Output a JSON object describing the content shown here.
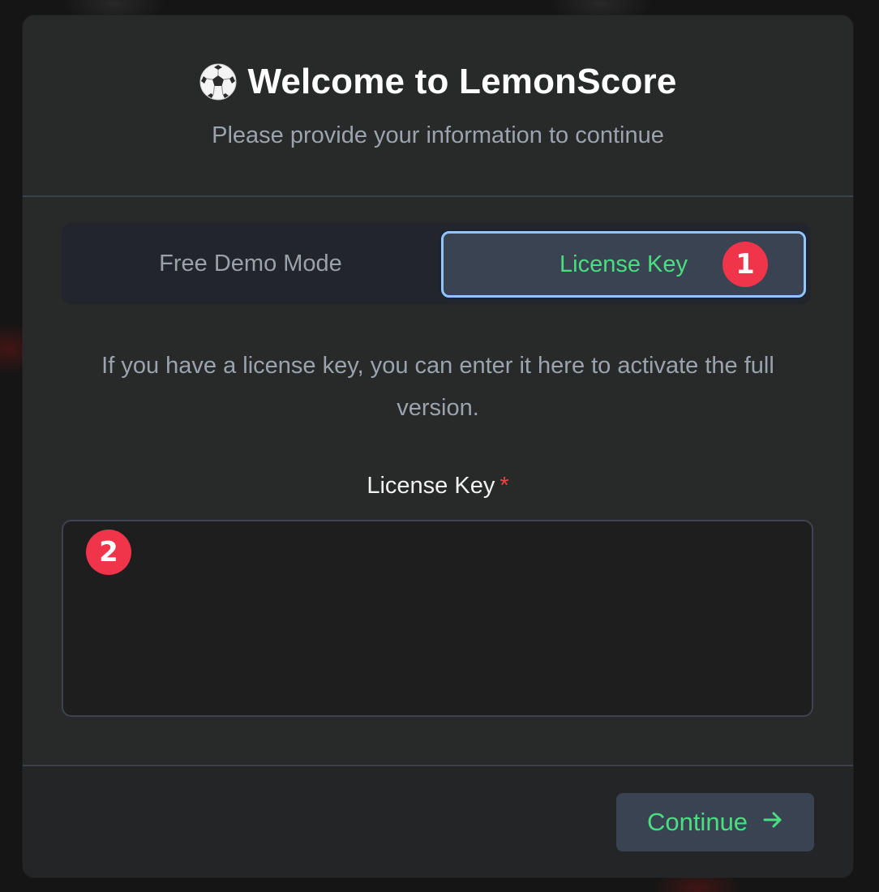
{
  "header": {
    "icon": "soccer-ball-icon",
    "title": "Welcome to LemonScore",
    "subtitle": "Please provide your information to continue"
  },
  "mode_toggle": {
    "options": [
      {
        "label": "Free Demo Mode",
        "selected": false
      },
      {
        "label": "License Key",
        "selected": true
      }
    ]
  },
  "annotations": {
    "badge_1": "1",
    "badge_2": "2"
  },
  "description": "If you have a license key, you can enter it here to activate the full version.",
  "license_field": {
    "label": "License Key",
    "required_marker": "*",
    "value": "",
    "placeholder": ""
  },
  "footer": {
    "continue_label": "Continue",
    "continue_icon": "arrow-right-icon"
  },
  "colors": {
    "accent_green": "#4ade80",
    "focus_ring": "#93c5fd",
    "badge_red": "#f0344a",
    "required_red": "#ef4444"
  }
}
